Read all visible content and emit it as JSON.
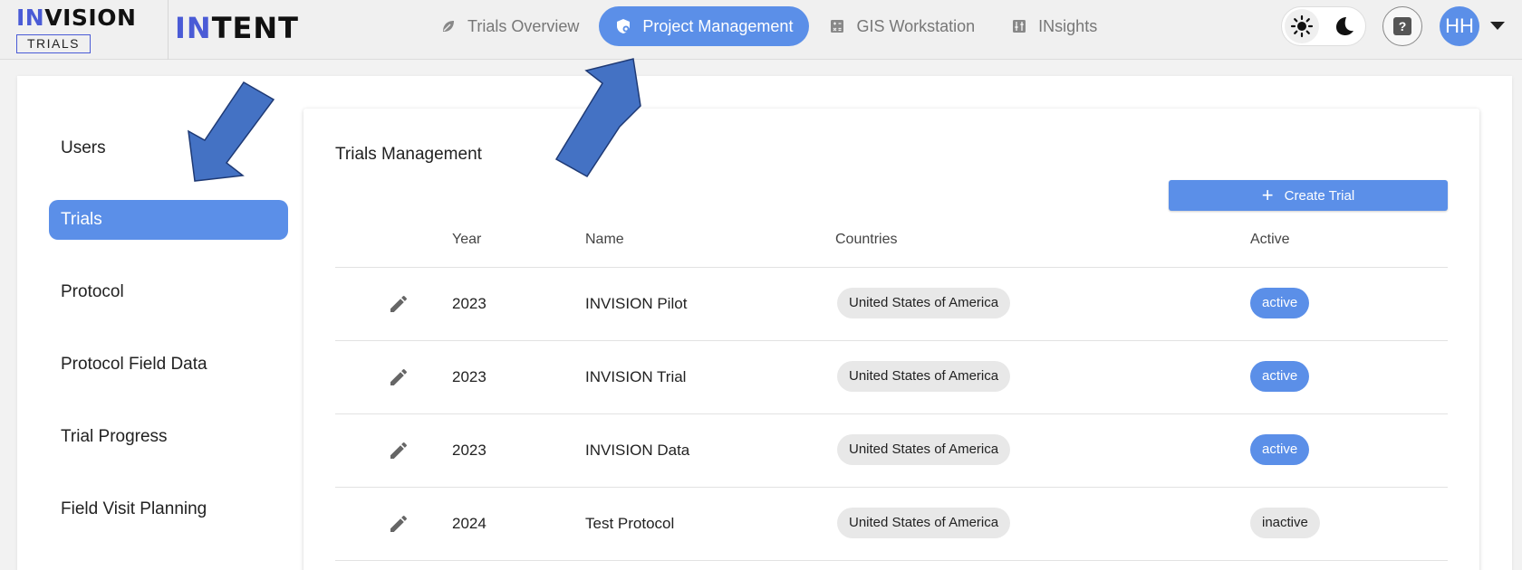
{
  "brand": {
    "name_hi": "IN",
    "name_rest": "VISION",
    "sub": "TRIALS"
  },
  "product": {
    "name_hi": "IN",
    "name_rest": "TENT"
  },
  "nav": [
    {
      "label": "Trials Overview",
      "icon": "leaf-icon",
      "active": false
    },
    {
      "label": "Project Management",
      "icon": "shield-gear-icon",
      "active": true
    },
    {
      "label": "GIS Workstation",
      "icon": "calculator-icon",
      "active": false
    },
    {
      "label": "INsights",
      "icon": "sliders-icon",
      "active": false
    }
  ],
  "header": {
    "help_glyph": "?",
    "avatar_initials": "HH"
  },
  "sidebar": {
    "items": [
      {
        "label": "Users",
        "active": false
      },
      {
        "label": "Trials",
        "active": true
      },
      {
        "label": "Protocol",
        "active": false
      },
      {
        "label": "Protocol Field Data",
        "active": false
      },
      {
        "label": "Trial Progress",
        "active": false
      },
      {
        "label": "Field Visit Planning",
        "active": false
      }
    ]
  },
  "main": {
    "title": "Trials Management",
    "create_label": "Create Trial",
    "columns": [
      "Year",
      "Name",
      "Countries",
      "Active"
    ],
    "rows": [
      {
        "year": "2023",
        "name": "INVISION Pilot",
        "country": "United States of America",
        "status": "active"
      },
      {
        "year": "2023",
        "name": "INVISION Trial",
        "country": "United States of America",
        "status": "active"
      },
      {
        "year": "2023",
        "name": "INVISION Data",
        "country": "United States of America",
        "status": "active"
      },
      {
        "year": "2024",
        "name": "Test Protocol",
        "country": "United States of America",
        "status": "inactive"
      }
    ]
  },
  "colors": {
    "accent": "#5b8fe8",
    "brand": "#4a5bd6",
    "annotation_arrow": "#4472c4"
  }
}
